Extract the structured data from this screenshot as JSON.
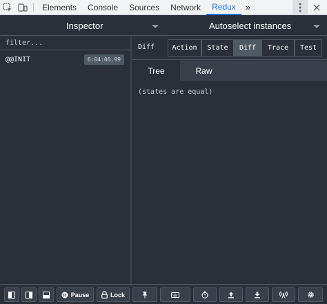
{
  "devtools": {
    "tabs": [
      "Elements",
      "Console",
      "Sources",
      "Network",
      "Redux"
    ],
    "active_tab": "Redux",
    "more_label": "»"
  },
  "header": {
    "monitor_label": "Inspector",
    "instance_label": "Autoselect instances"
  },
  "left_panel": {
    "filter_placeholder": "filter...",
    "actions": [
      {
        "name": "@@INIT",
        "time": "6:04:00.99"
      }
    ]
  },
  "right_panel": {
    "mode_label": "Diff",
    "segment_buttons": [
      "Action",
      "State",
      "Diff",
      "Trace",
      "Test"
    ],
    "selected_segment": "Diff",
    "view_tabs": [
      "Tree",
      "Raw"
    ],
    "active_view_tab": "Tree",
    "message": "(states are equal)"
  },
  "footer": {
    "pause_label": "Pause",
    "lock_label": "Lock",
    "icons": [
      "layout-left-icon",
      "layout-right-icon",
      "layout-bottom-icon",
      "pause-icon",
      "lock-icon",
      "pin-icon",
      "keyboard-icon",
      "timer-icon",
      "upload-icon",
      "download-icon",
      "remote-icon",
      "settings-icon"
    ]
  },
  "colors": {
    "background": "#2a2f3a",
    "border": "#4f5a65",
    "selected": "#4f5a65",
    "devtools_active": "#1a73e8"
  }
}
